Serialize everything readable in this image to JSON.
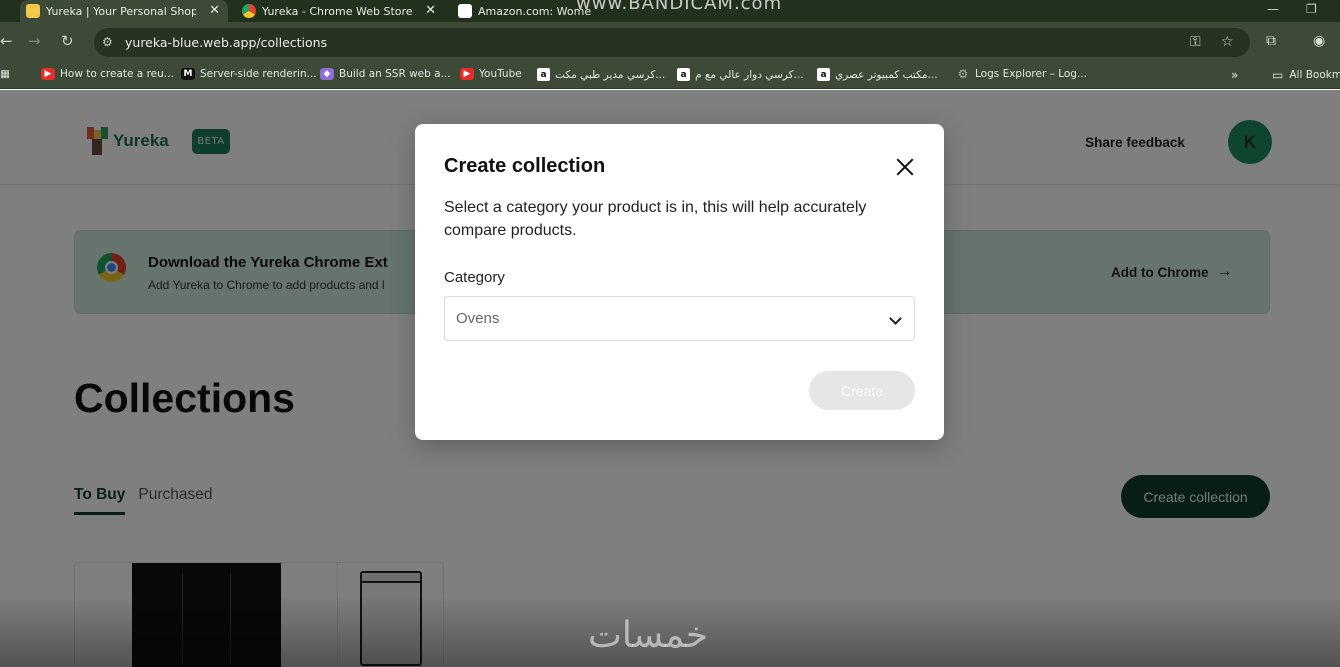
{
  "browser": {
    "tabs": [
      {
        "title": "Yureka | Your Personal Shoppin",
        "close": "✕"
      },
      {
        "title": "Yureka - Chrome Web Store",
        "close": "✕"
      },
      {
        "title": "Amazon.com: Wome",
        "close": ""
      }
    ],
    "url": "yureka-blue.web.app/collections",
    "bookmarks": [
      {
        "label": "How to create a reu...",
        "icon": "youtube-icon"
      },
      {
        "label": "Server-side renderin...",
        "icon": "medium-icon"
      },
      {
        "label": "Build an SSR web a...",
        "icon": "bookmark-icon"
      },
      {
        "label": "YouTube",
        "icon": "youtube-icon"
      },
      {
        "label": "كرسي مدير طبي مكت...",
        "icon": "amazon-icon"
      },
      {
        "label": "كرسي دوار عالي مع م...",
        "icon": "amazon-icon"
      },
      {
        "label": "مكتب كمبيوتر عصري...",
        "icon": "amazon-icon"
      },
      {
        "label": "Logs Explorer – Log...",
        "icon": "gear-icon"
      }
    ],
    "bookmarks_more": "»",
    "all_bookmarks": "All Bookm"
  },
  "header": {
    "logo_text": "Yureka",
    "beta_badge": "BETA",
    "share_feedback": "Share feedback",
    "avatar_initial": "K"
  },
  "banner": {
    "title": "Download the Yureka Chrome Ext",
    "subtitle": "Add Yureka to Chrome to add products and l",
    "cta": "Add to Chrome",
    "cta_arrow": "→"
  },
  "main": {
    "title": "Collections",
    "tabs": [
      {
        "label": "To Buy",
        "active": true
      },
      {
        "label": "Purchased",
        "active": false
      }
    ],
    "create_button": "Create collection"
  },
  "modal": {
    "title": "Create collection",
    "description": "Select a category your product is in, this will help accurately compare products.",
    "category_label": "Category",
    "category_value": "Ovens",
    "create_button": "Create"
  },
  "overlay_text": {
    "recorder": "www.BANDICAM.com",
    "watermark": "خمسات"
  },
  "colors": {
    "brand_green": "#1d8a5e",
    "dark_button": "#103a2c",
    "banner_bg": "#cfe8dd"
  }
}
